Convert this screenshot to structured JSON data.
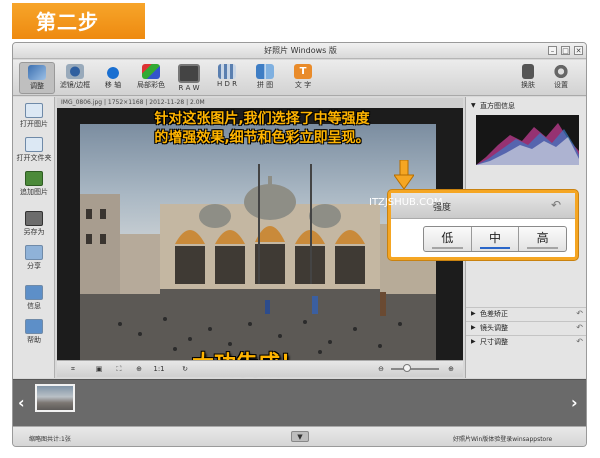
{
  "step_banner": "第二步",
  "window": {
    "title": "好照片 Windows 版",
    "controls": [
      "–",
      "□",
      "✕"
    ]
  },
  "toolbar": {
    "tools": [
      {
        "label": "调整",
        "icon": "adjust-icon",
        "active": true
      },
      {
        "label": "滤镜/边框",
        "icon": "filter-icon"
      },
      {
        "label": "移 轴",
        "icon": "tilt-shift-icon"
      },
      {
        "label": "局部彩色",
        "icon": "partial-color-icon"
      },
      {
        "label": "R A W",
        "icon": "raw-icon"
      },
      {
        "label": "H D R",
        "icon": "hdr-icon"
      },
      {
        "label": "拼 图",
        "icon": "collage-icon"
      },
      {
        "label": "文 字",
        "icon": "text-icon"
      }
    ],
    "right": [
      {
        "label": "换肤",
        "icon": "shirt-icon"
      },
      {
        "label": "设置",
        "icon": "gear-icon"
      }
    ]
  },
  "sidebar": {
    "items": [
      {
        "label": "打开图片",
        "icon": "open-image-icon"
      },
      {
        "label": "打开文件夹",
        "icon": "open-folder-icon"
      },
      {
        "label": "追加图片",
        "icon": "add-image-icon"
      },
      {
        "label": "另存为",
        "icon": "save-as-icon"
      },
      {
        "label": "分享",
        "icon": "share-icon"
      },
      {
        "label": "信息",
        "icon": "info-icon"
      },
      {
        "label": "帮助",
        "icon": "help-icon"
      }
    ]
  },
  "image_info": "IMG_0806.jpg  |  1752×1168  |  2012-11-28  |  2.0M",
  "caption": {
    "line1": "针对这张图片,我们选择了中等强度",
    "line2": "的增强效果,细节和色彩立即呈现。"
  },
  "done_text": "大功告成！",
  "bottom_tools": {
    "ratio_label": "1:1"
  },
  "right_panel": {
    "histogram_title": "直方图信息",
    "sections": [
      "色差矫正",
      "镜头调整",
      "尺寸调整"
    ]
  },
  "popup": {
    "title": "强度",
    "watermark": "ITZJSHUB.COM",
    "options": [
      "低",
      "中",
      "高"
    ],
    "selected": "中",
    "accent": "#f5a623"
  },
  "status_bar": {
    "left": "缩略图共计:1张",
    "right": "好照片Win版体验登录winsappstore"
  }
}
